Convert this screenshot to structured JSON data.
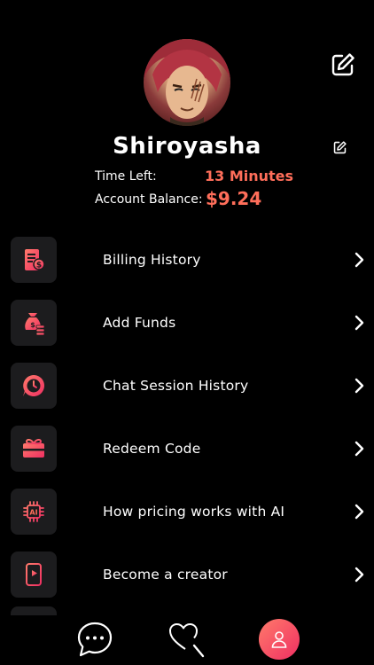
{
  "profile": {
    "username": "Shiroyasha",
    "time_left_label": "Time Left:",
    "time_left_value": "13 Minutes",
    "balance_label": "Account Balance:",
    "balance_value": "$9.24"
  },
  "menu": [
    {
      "label": "Billing History",
      "icon": "receipt-dollar-icon"
    },
    {
      "label": "Add Funds",
      "icon": "money-bag-icon"
    },
    {
      "label": "Chat Session History",
      "icon": "clock-chat-icon"
    },
    {
      "label": "Redeem Code",
      "icon": "gift-card-icon"
    },
    {
      "label": "How pricing works with AI",
      "icon": "ai-chip-icon"
    },
    {
      "label": "Become a creator",
      "icon": "creator-video-icon"
    }
  ],
  "tabs": [
    {
      "name": "chats",
      "icon": "chat-bubble-icon"
    },
    {
      "name": "search",
      "icon": "heart-search-icon"
    },
    {
      "name": "profile",
      "icon": "user-icon",
      "active": true
    }
  ],
  "colors": {
    "accent": "#ff6e5a",
    "icon_gradient_start": "#ff7a6b",
    "icon_gradient_end": "#ef2f62",
    "background": "#000000",
    "tile": "#1c1c1e"
  }
}
